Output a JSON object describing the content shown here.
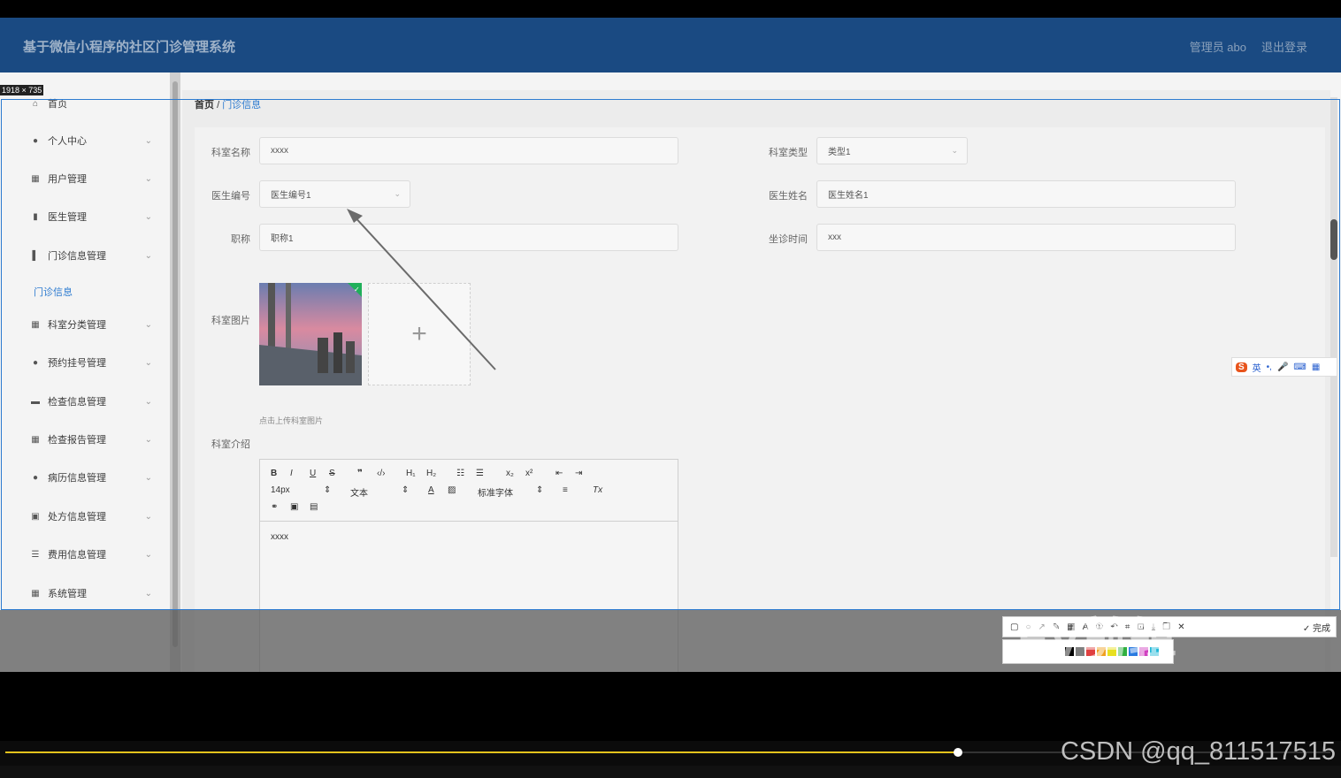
{
  "header": {
    "title": "基于微信小程序的社区门诊管理系统",
    "admin": "管理员 abo",
    "logout": "退出登录"
  },
  "dim_label": "1918 × 735",
  "sidebar": {
    "items": [
      {
        "label": "首页",
        "icon": "home-icon"
      },
      {
        "label": "个人中心",
        "icon": "user-icon"
      },
      {
        "label": "用户管理",
        "icon": "grid-icon"
      },
      {
        "label": "医生管理",
        "icon": "bars-icon"
      },
      {
        "label": "门诊信息管理",
        "icon": "chart-icon"
      },
      {
        "label": "门诊信息",
        "icon": ""
      },
      {
        "label": "科室分类管理",
        "icon": "grid-icon"
      },
      {
        "label": "预约挂号管理",
        "icon": "pin-icon"
      },
      {
        "label": "检查信息管理",
        "icon": "monitor-icon"
      },
      {
        "label": "检查报告管理",
        "icon": "grid-icon"
      },
      {
        "label": "病历信息管理",
        "icon": "user-icon"
      },
      {
        "label": "处方信息管理",
        "icon": "image-icon"
      },
      {
        "label": "费用信息管理",
        "icon": "list-icon"
      },
      {
        "label": "系统管理",
        "icon": "grid-icon"
      }
    ]
  },
  "breadcrumb": {
    "home": "首页",
    "sep": "/",
    "current": "门诊信息"
  },
  "form": {
    "dept_name_label": "科室名称",
    "dept_name_value": "xxxx",
    "dept_type_label": "科室类型",
    "dept_type_value": "类型1",
    "doctor_no_label": "医生编号",
    "doctor_no_value": "医生编号1",
    "doctor_name_label": "医生姓名",
    "doctor_name_value": "医生姓名1",
    "title_label": "职称",
    "title_value": "职称1",
    "hours_label": "坐诊时间",
    "hours_value": "xxx",
    "image_label": "科室图片",
    "image_hint": "点击上传科室图片",
    "intro_label": "科室介绍",
    "intro_value": "xxxx"
  },
  "editor": {
    "font_size": "14px",
    "text_style": "文本",
    "font_family": "标准字体"
  },
  "ime": {
    "lang": "英"
  },
  "snip": {
    "done": "完成"
  },
  "watermark": "CSDN @qq_811517515",
  "ev_watermark": "EV剪辑"
}
